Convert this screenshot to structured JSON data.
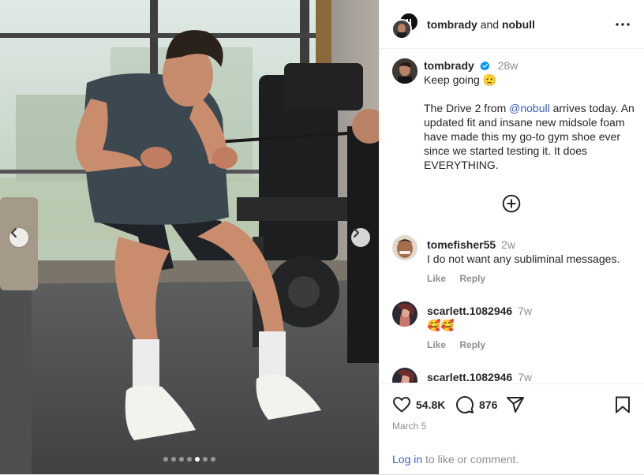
{
  "header": {
    "user1": "tombrady",
    "conjunction": "and",
    "user2": "nobull"
  },
  "caption": {
    "username": "tombrady",
    "time": "28w",
    "line1": "Keep going 🫡",
    "before_mention": "The Drive 2 from ",
    "mention": "@nobull",
    "after_mention": " arrives today. An updated fit and insane new midsole foam have made this my go-to gym shoe ever since we started testing it. It does EVERYTHING."
  },
  "comments": [
    {
      "username": "tomefisher55",
      "time": "2w",
      "text": "I do not want any subliminal messages.",
      "like": "Like",
      "reply": "Reply"
    },
    {
      "username": "scarlett.1082946",
      "time": "7w",
      "text": "🥰🥰",
      "like": "Like",
      "reply": "Reply"
    },
    {
      "username": "scarlett.1082946",
      "time": "7w"
    }
  ],
  "stats": {
    "likes": "54.8K",
    "comments": "876"
  },
  "date": "March 5",
  "login": {
    "link": "Log in",
    "text": " to like or comment."
  },
  "carousel": {
    "total": 7,
    "active_index": 4
  },
  "colors": {
    "link": "#3b5fc0",
    "verified": "#0095f6",
    "muted": "#8e8e8e",
    "text": "#262626"
  }
}
